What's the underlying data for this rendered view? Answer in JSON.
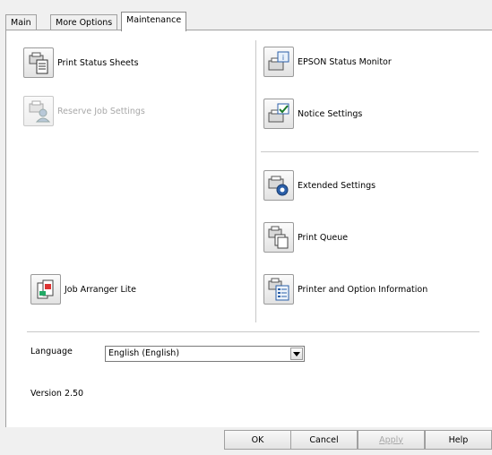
{
  "tabs": [
    {
      "label": "Main"
    },
    {
      "label": "More Options"
    },
    {
      "label": "Maintenance"
    }
  ],
  "utilities": {
    "left": [
      {
        "label": "Print Status Sheets",
        "enabled": true,
        "icon": "print-status-sheets-icon"
      },
      {
        "label": "Reserve Job Settings",
        "enabled": false,
        "icon": "reserve-job-settings-icon"
      },
      {
        "label": "Job Arranger Lite",
        "enabled": true,
        "icon": "job-arranger-lite-icon"
      }
    ],
    "right": [
      {
        "label": "EPSON Status Monitor",
        "enabled": true,
        "icon": "status-monitor-icon"
      },
      {
        "label": "Notice Settings",
        "enabled": true,
        "icon": "notice-settings-icon"
      },
      {
        "label": "Extended Settings",
        "enabled": true,
        "icon": "extended-settings-icon"
      },
      {
        "label": "Print Queue",
        "enabled": true,
        "icon": "print-queue-icon"
      },
      {
        "label": "Printer and Option Information",
        "enabled": true,
        "icon": "printer-option-info-icon"
      }
    ]
  },
  "language": {
    "label": "Language",
    "value": "English (English)"
  },
  "version": "Version 2.50",
  "buttons": {
    "ok": "OK",
    "cancel": "Cancel",
    "apply": "Apply",
    "help": "Help"
  }
}
